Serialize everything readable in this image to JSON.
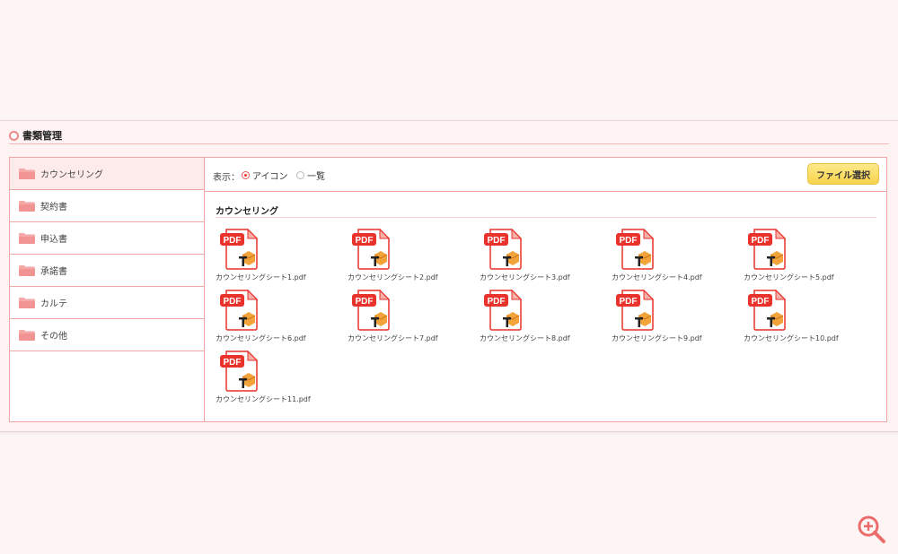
{
  "section": {
    "title": "書類管理"
  },
  "sidebar": {
    "items": [
      {
        "label": "カウンセリング",
        "active": true
      },
      {
        "label": "契約書"
      },
      {
        "label": "申込書"
      },
      {
        "label": "承諾書"
      },
      {
        "label": "カルテ"
      },
      {
        "label": "その他"
      }
    ]
  },
  "toolbar": {
    "view_label": "表示：",
    "options": [
      {
        "label": "アイコン",
        "selected": true
      },
      {
        "label": "一覧",
        "selected": false
      }
    ],
    "file_select_label": "ファイル選択"
  },
  "content": {
    "title": "カウンセリング",
    "files": [
      {
        "name": "カウンセリングシート1.pdf",
        "icon": "pdf-icon"
      },
      {
        "name": "カウンセリングシート2.pdf",
        "icon": "pdf-icon"
      },
      {
        "name": "カウンセリングシート3.pdf",
        "icon": "pdf-icon"
      },
      {
        "name": "カウンセリングシート4.pdf",
        "icon": "pdf-icon"
      },
      {
        "name": "カウンセリングシート5.pdf",
        "icon": "pdf-icon"
      },
      {
        "name": "カウンセリングシート6.pdf",
        "icon": "pdf-icon"
      },
      {
        "name": "カウンセリングシート7.pdf",
        "icon": "pdf-icon"
      },
      {
        "name": "カウンセリングシート8.pdf",
        "icon": "pdf-icon"
      },
      {
        "name": "カウンセリングシート9.pdf",
        "icon": "pdf-icon"
      },
      {
        "name": "カウンセリングシート10.pdf",
        "icon": "pdf-icon"
      },
      {
        "name": "カウンセリングシート11.pdf",
        "icon": "pdf-icon"
      }
    ]
  },
  "icons": {
    "section": "circle-icon",
    "folder": "folder-icon",
    "zoom": "zoom-in-icon",
    "pdf_badge": "PDF"
  },
  "colors": {
    "accent": "#f08a8a",
    "border": "#f1a6a6",
    "button": "#f7d44c",
    "pdf_red": "#e8322b"
  }
}
